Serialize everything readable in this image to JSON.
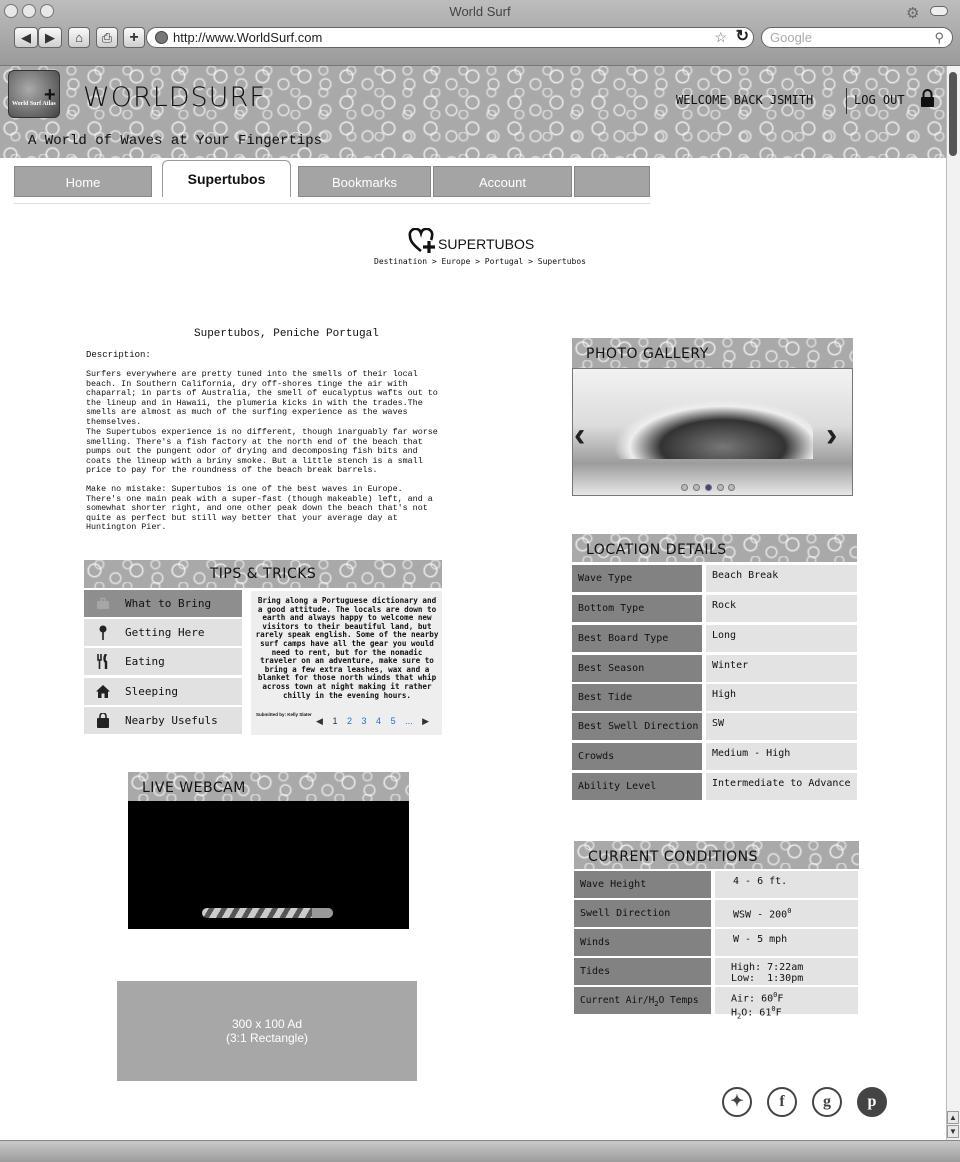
{
  "browser": {
    "title": "World Surf",
    "url": "http://www.WorldSurf.com",
    "search_placeholder": "Google"
  },
  "header": {
    "site_title": "WORLDSURF",
    "logo_text": "World Surf Atlas",
    "tagline": "A World of Waves at Your Fingertips",
    "welcome": "WELCOME BACK JSMITH",
    "logout": "LOG OUT"
  },
  "nav": {
    "tabs": [
      {
        "label": "Home"
      },
      {
        "label": "Supertubos"
      },
      {
        "label": "Bookmarks"
      },
      {
        "label": "Account"
      },
      {
        "label": ""
      }
    ]
  },
  "page": {
    "title": "SUPERTUBOS",
    "breadcrumb": "Destination > Europe > Portugal > Supertubos"
  },
  "description": {
    "title": "Supertubos, Peniche Portugal",
    "label": "Description:",
    "paragraphs": [
      "Surfers everywhere are pretty tuned into the smells of their local beach. In Southern California, dry off-shores tinge the air with chaparral; in parts of Australia, the smell of eucalyptus wafts out to the lineup and in Hawaii, the plumeria kicks in with the trades.The smells are almost as much of the surfing experience as the waves themselves.",
      "The Supertubos experience is no different, though inarguably far worse smelling. There's a fish factory at the north end of the beach that pumps out the pungent odor of drying and decomposing fish bits and coats the lineup with a briny smoke. But a little stench is a small price to pay for the roundness of the beach break barrels.",
      "Make no mistake: Supertubos is one of the best waves in Europe. There's one main peak with a super-fast (though makeable) left, and a somewhat shorter right, and one other peak down the beach that's not quite as perfect but still way better that your average day at Huntington Pier."
    ]
  },
  "tips": {
    "heading": "TIPS & TRICKS",
    "items": [
      {
        "label": "What to Bring",
        "icon": "briefcase-icon"
      },
      {
        "label": "Getting Here",
        "icon": "map-pin-icon"
      },
      {
        "label": "Eating",
        "icon": "fork-knife-icon"
      },
      {
        "label": "Sleeping",
        "icon": "house-icon"
      },
      {
        "label": "Nearby Usefuls",
        "icon": "shopping-bag-icon"
      }
    ],
    "body": "Bring along a Portuguese dictionary and a good attitude. The locals are down to earth and always happy to welcome new visitors to their beautiful land, but rarely speak english. Some of the nearby surf camps have all the gear you would need to rent, but for the nomadic traveler on an adventure, make sure to bring a few extra leashes, wax and a blanket for those north winds that whip across town at night making it rather chilly in the evening hours.",
    "submitted_by": "Submitted by: Kelly Slater",
    "pages": [
      "1",
      "2",
      "3",
      "4",
      "5",
      "..."
    ]
  },
  "webcam": {
    "heading": "LIVE WEBCAM"
  },
  "ad": {
    "line1": "300 x 100 Ad",
    "line2": "(3:1 Rectangle)"
  },
  "gallery": {
    "heading": "PHOTO GALLERY",
    "dot_count": 5,
    "active_dot": 3
  },
  "location": {
    "heading": "LOCATION DETAILS",
    "rows": [
      {
        "label": "Wave Type",
        "value": "Beach Break"
      },
      {
        "label": "Bottom Type",
        "value": "Rock"
      },
      {
        "label": "Best Board Type",
        "value": "Long"
      },
      {
        "label": "Best Season",
        "value": "Winter"
      },
      {
        "label": "Best Tide",
        "value": "High"
      },
      {
        "label": "Best Swell Direction",
        "value": "SW"
      },
      {
        "label": "Crowds",
        "value": "Medium - High"
      },
      {
        "label": "Ability Level",
        "value": "Intermediate to Advance"
      }
    ]
  },
  "conditions": {
    "heading": "CURRENT CONDITIONS",
    "rows": [
      {
        "label": "Wave Height",
        "value": "4 - 6 ft."
      },
      {
        "label": "Swell Direction",
        "value": "WSW - 200",
        "sup": "0"
      },
      {
        "label": "Winds",
        "value": "W - 5 mph"
      },
      {
        "label": "Tides",
        "value": "High: 7:22am",
        "value2": "Low:  1:30pm"
      },
      {
        "label": "Current Air/H",
        "label_sub": "2",
        "label_end": "O Temps",
        "value": "Air: 60",
        "sup": "0",
        "unit": "F",
        "value2": "H",
        "sub2": "2",
        "value2b": "O: 61",
        "sup2": "0",
        "unit2": "F"
      }
    ]
  },
  "social": {
    "icons": [
      "twitter-icon",
      "facebook-icon",
      "google-plus-icon",
      "pinterest-icon"
    ]
  }
}
